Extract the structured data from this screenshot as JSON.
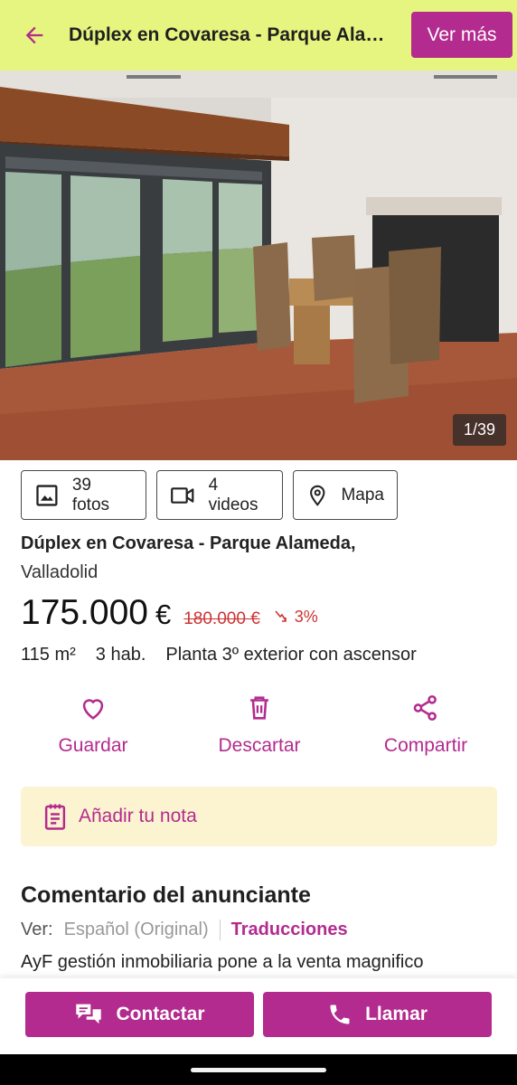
{
  "header": {
    "title": "Dúplex en Covaresa - Parque Alameda",
    "ver_mas": "Ver más"
  },
  "gallery": {
    "counter": "1/39"
  },
  "media": {
    "photos": "39 fotos",
    "videos": "4 videos",
    "map": "Mapa"
  },
  "listing": {
    "title": "Dúplex en Covaresa - Parque Alameda,",
    "city": "Valladolid",
    "price": "175.000",
    "currency": "€",
    "old_price": "180.000 €",
    "drop": "3%",
    "features": [
      "115 m²",
      "3 hab.",
      "Planta 3º exterior con ascensor"
    ]
  },
  "actions": {
    "save": "Guardar",
    "discard": "Descartar",
    "share": "Compartir"
  },
  "note": {
    "label": "Añadir tu nota"
  },
  "comment": {
    "heading": "Comentario del anunciante",
    "ver_label": "Ver:",
    "original": "Español (Original)",
    "translations": "Traducciones",
    "text": "AyF gestión inmobiliaria pone a la venta magnifico"
  },
  "bottom": {
    "contact": "Contactar",
    "call": "Llamar"
  },
  "colors": {
    "accent": "#b32b8e",
    "header_bg": "#e6f57f",
    "note_bg": "#fcf3d1",
    "price_drop": "#cc3333"
  }
}
